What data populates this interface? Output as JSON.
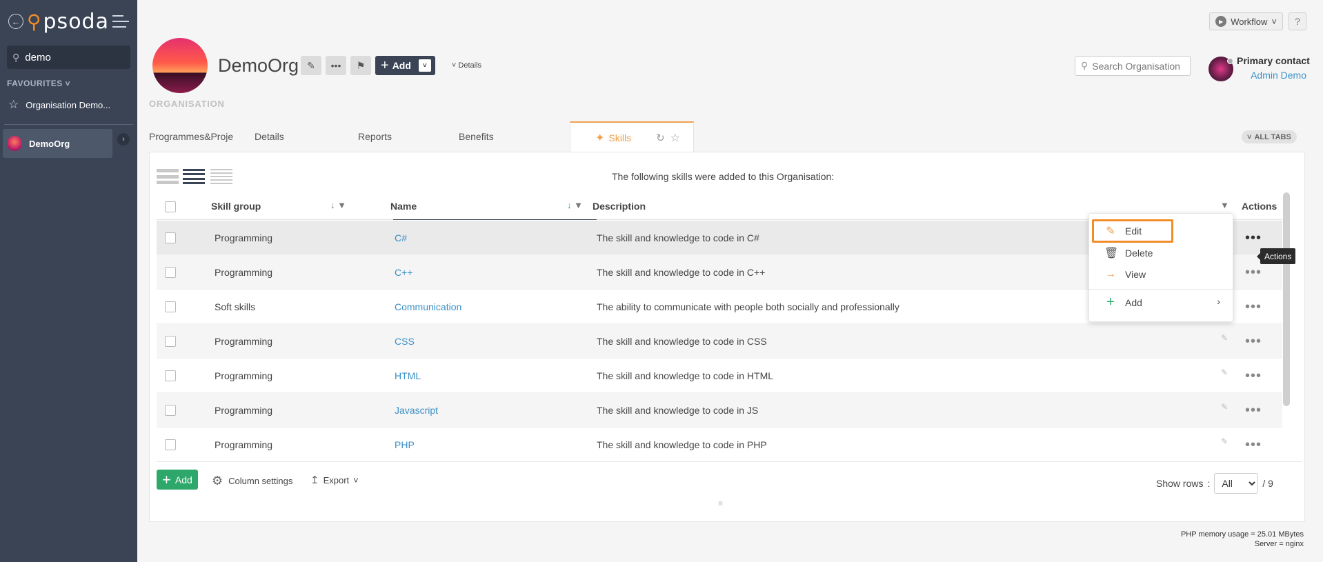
{
  "sidebar": {
    "logo_text": "psoda",
    "search_value": "demo",
    "favourites_title": "FAVOURITES",
    "favourite_item": "Organisation Demo...",
    "org_item": "DemoOrg"
  },
  "header": {
    "workflow_label": "Workflow",
    "help_label": "?",
    "org_title": "DemoOrg",
    "add_label": "Add",
    "details_label": "Details",
    "org_label": "ORGANISATION",
    "search_placeholder": "Search Organisation",
    "primary_contact_title": "Primary contact",
    "primary_contact_name": "Admin Demo"
  },
  "tabs": {
    "items": [
      {
        "label": "Programmes&Proje"
      },
      {
        "label": "Details"
      },
      {
        "label": "Reports"
      },
      {
        "label": "Benefits"
      }
    ],
    "active_label": "Skills",
    "all_tabs_label": "ALL TABS"
  },
  "table": {
    "intro": "The following skills were added to this Organisation:",
    "headers": {
      "skill_group": "Skill group",
      "name": "Name",
      "description": "Description",
      "actions": "Actions"
    },
    "rows": [
      {
        "group": "Programming",
        "name": "C#",
        "description": "The skill and knowledge to code in C#"
      },
      {
        "group": "Programming",
        "name": "C++",
        "description": "The skill and knowledge to code in C++"
      },
      {
        "group": "Soft skills",
        "name": "Communication",
        "description": "The ability to communicate with people both socially and professionally"
      },
      {
        "group": "Programming",
        "name": "CSS",
        "description": "The skill and knowledge to code in CSS"
      },
      {
        "group": "Programming",
        "name": "HTML",
        "description": "The skill and knowledge to code in HTML"
      },
      {
        "group": "Programming",
        "name": "Javascript",
        "description": "The skill and knowledge to code in JS"
      },
      {
        "group": "Programming",
        "name": "PHP",
        "description": "The skill and knowledge to code in PHP"
      }
    ]
  },
  "context_menu": {
    "edit": "Edit",
    "delete": "Delete",
    "view": "View",
    "add": "Add"
  },
  "tooltip": "Actions",
  "footer": {
    "add_label": "Add",
    "column_settings": "Column settings",
    "export": "Export",
    "show_rows": "Show rows",
    "show_rows_value": "All",
    "total": "/ 9"
  },
  "server_info": {
    "memory": "PHP memory usage = 25.01 MBytes",
    "server": "Server = nginx"
  },
  "colors": {
    "sidebar": "#3a4455",
    "accent_orange": "#f28c28",
    "link_blue": "#3a8fc6",
    "add_green": "#2ea86a"
  }
}
